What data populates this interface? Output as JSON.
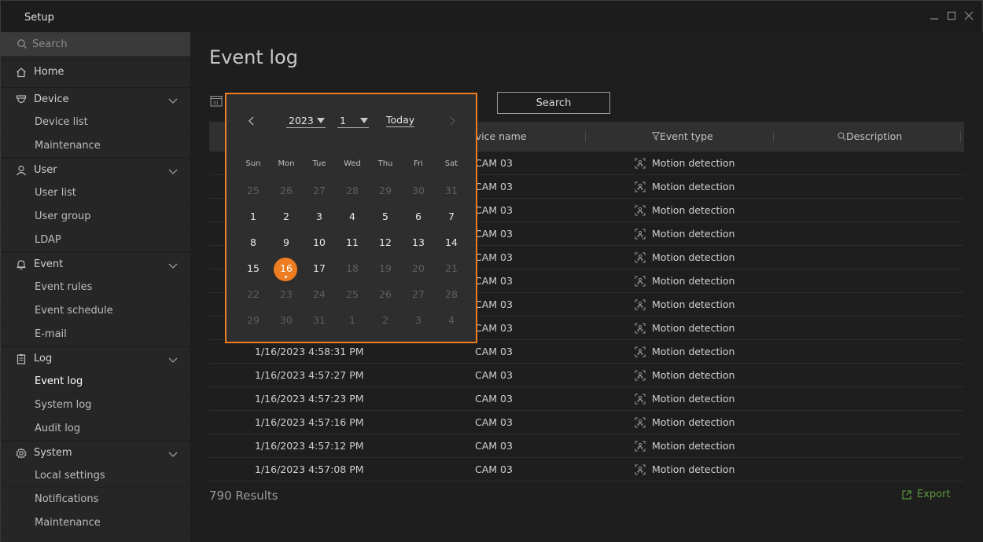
{
  "window": {
    "title": "Setup"
  },
  "sidebar": {
    "search_placeholder": "Search",
    "items": [
      {
        "label": "Home",
        "type": "group"
      },
      {
        "label": "Device",
        "type": "group"
      },
      {
        "label": "Device list",
        "type": "sub"
      },
      {
        "label": "Maintenance",
        "type": "sub"
      },
      {
        "label": "User",
        "type": "group"
      },
      {
        "label": "User list",
        "type": "sub"
      },
      {
        "label": "User group",
        "type": "sub"
      },
      {
        "label": "LDAP",
        "type": "sub"
      },
      {
        "label": "Event",
        "type": "group"
      },
      {
        "label": "Event rules",
        "type": "sub"
      },
      {
        "label": "Event schedule",
        "type": "sub"
      },
      {
        "label": "E-mail",
        "type": "sub"
      },
      {
        "label": "Log",
        "type": "group"
      },
      {
        "label": "Event log",
        "type": "sub",
        "active": true
      },
      {
        "label": "System log",
        "type": "sub"
      },
      {
        "label": "Audit log",
        "type": "sub"
      },
      {
        "label": "System",
        "type": "group"
      },
      {
        "label": "Local settings",
        "type": "sub"
      },
      {
        "label": "Notifications",
        "type": "sub"
      },
      {
        "label": "Maintenance",
        "type": "sub"
      }
    ]
  },
  "main": {
    "title": "Event log",
    "search_button": "Search",
    "columns": {
      "device_name": "evice name",
      "event_type": "Event type",
      "description": "Description"
    },
    "rows": [
      {
        "time": "",
        "device": "CAM 03",
        "event": "Motion detection"
      },
      {
        "time": "",
        "device": "CAM 03",
        "event": "Motion detection"
      },
      {
        "time": "",
        "device": "CAM 03",
        "event": "Motion detection"
      },
      {
        "time": "",
        "device": "CAM 03",
        "event": "Motion detection"
      },
      {
        "time": "",
        "device": "CAM 03",
        "event": "Motion detection"
      },
      {
        "time": "",
        "device": "CAM 03",
        "event": "Motion detection"
      },
      {
        "time": "",
        "device": "CAM 03",
        "event": "Motion detection"
      },
      {
        "time": "",
        "device": "CAM 03",
        "event": "Motion detection"
      },
      {
        "time": "1/16/2023 4:58:31 PM",
        "device": "CAM 03",
        "event": "Motion detection"
      },
      {
        "time": "1/16/2023 4:57:27 PM",
        "device": "CAM 03",
        "event": "Motion detection"
      },
      {
        "time": "1/16/2023 4:57:23 PM",
        "device": "CAM 03",
        "event": "Motion detection"
      },
      {
        "time": "1/16/2023 4:57:16 PM",
        "device": "CAM 03",
        "event": "Motion detection"
      },
      {
        "time": "1/16/2023 4:57:12 PM",
        "device": "CAM 03",
        "event": "Motion detection"
      },
      {
        "time": "1/16/2023 4:57:08 PM",
        "device": "CAM 03",
        "event": "Motion detection"
      }
    ],
    "results": "790 Results",
    "export": "Export"
  },
  "calendar": {
    "year": "2023",
    "month": "1",
    "today": "Today",
    "weekdays": [
      "Sun",
      "Mon",
      "Tue",
      "Wed",
      "Thu",
      "Fri",
      "Sat"
    ],
    "weeks": [
      [
        "25",
        "26",
        "27",
        "28",
        "29",
        "30",
        "31"
      ],
      [
        "1",
        "2",
        "3",
        "4",
        "5",
        "6",
        "7"
      ],
      [
        "8",
        "9",
        "10",
        "11",
        "12",
        "13",
        "14"
      ],
      [
        "15",
        "16",
        "17",
        "18",
        "19",
        "20",
        "21"
      ],
      [
        "22",
        "23",
        "24",
        "25",
        "26",
        "27",
        "28"
      ],
      [
        "29",
        "30",
        "31",
        "1",
        "2",
        "3",
        "4"
      ]
    ],
    "selected_day": "16",
    "colors": {
      "accent": "#ee7d22",
      "export": "#5c9a3c"
    }
  }
}
